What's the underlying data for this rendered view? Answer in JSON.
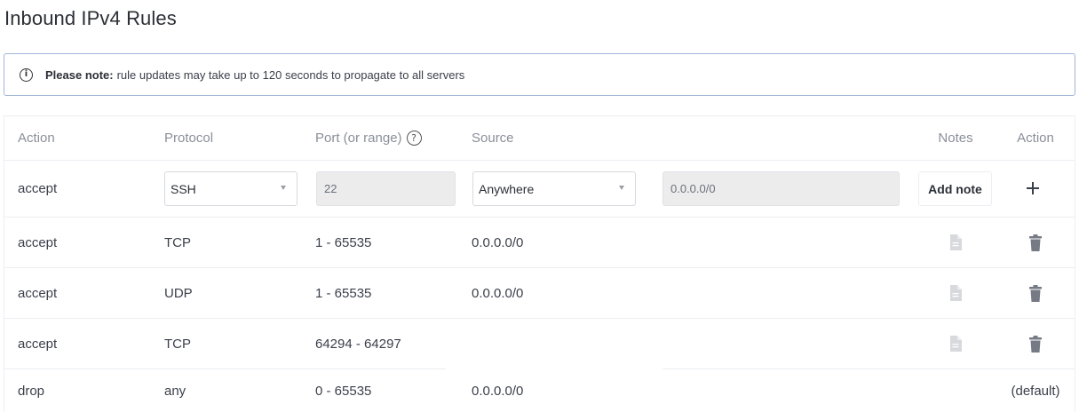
{
  "page": {
    "title": "Inbound IPv4 Rules"
  },
  "notice": {
    "bold": "Please note:",
    "text": "rule updates may take up to 120 seconds to propagate to all servers"
  },
  "table": {
    "headers": {
      "action": "Action",
      "protocol": "Protocol",
      "port": "Port (or range)",
      "source": "Source",
      "notes": "Notes",
      "action2": "Action"
    },
    "new_rule": {
      "action": "accept",
      "protocol": "SSH",
      "port": "22",
      "source": "Anywhere",
      "cidr": "0.0.0.0/0",
      "add_note_label": "Add note"
    },
    "rows": [
      {
        "action": "accept",
        "protocol": "TCP",
        "port": "1 - 65535",
        "source": "0.0.0.0/0"
      },
      {
        "action": "accept",
        "protocol": "UDP",
        "port": "1 - 65535",
        "source": "0.0.0.0/0"
      },
      {
        "action": "accept",
        "protocol": "TCP",
        "port": "64294 - 64297",
        "source": ""
      }
    ],
    "default_row": {
      "action": "drop",
      "protocol": "any",
      "port": "0 - 65535",
      "source": "0.0.0.0/0",
      "label": "(default)"
    }
  },
  "icons": {
    "info": "info-icon",
    "help": "question-circle-icon",
    "note": "note-icon",
    "delete": "trash-icon",
    "add": "plus-icon",
    "caret": "caret-down-icon"
  }
}
